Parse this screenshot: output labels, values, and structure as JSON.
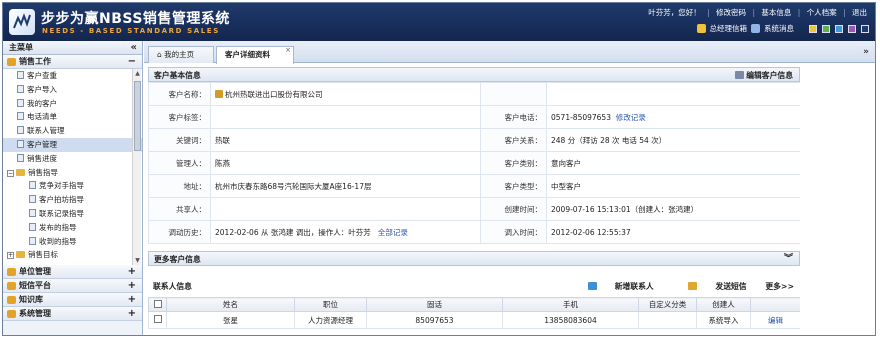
{
  "header": {
    "brand": "步步为赢NBSS销售管理系统",
    "tagline": "NEEDS - BASED STANDARD SALES",
    "user_greeting": "叶芬芳，您好！",
    "links": [
      "修改密码",
      "基本信息",
      "个人档案",
      "退出"
    ],
    "mailbox": "总经理信箱",
    "messages": "系统消息",
    "theme_colors": [
      "#e8c53a",
      "#5fb04a",
      "#3a9ad9",
      "#9b59b6",
      "#1f3a6a"
    ]
  },
  "sidebar": {
    "title": "主菜单",
    "collapse": "«",
    "group_sales": "销售工作",
    "items": [
      {
        "label": "客户查重",
        "type": "doc",
        "indent": 1
      },
      {
        "label": "客户导入",
        "type": "doc",
        "indent": 1
      },
      {
        "label": "我的客户",
        "type": "doc",
        "indent": 1
      },
      {
        "label": "电话清单",
        "type": "doc",
        "indent": 1
      },
      {
        "label": "联系人管理",
        "type": "doc",
        "indent": 1
      },
      {
        "label": "客户管理",
        "type": "doc",
        "indent": 1,
        "selected": true
      },
      {
        "label": "销售进度",
        "type": "doc",
        "indent": 1
      },
      {
        "label": "销售指导",
        "type": "folder",
        "indent": 0
      },
      {
        "label": "竞争对手指导",
        "type": "doc",
        "indent": 2
      },
      {
        "label": "客户拍坊指导",
        "type": "doc",
        "indent": 2
      },
      {
        "label": "联系记录指导",
        "type": "doc",
        "indent": 2
      },
      {
        "label": "发布的指导",
        "type": "doc",
        "indent": 2
      },
      {
        "label": "收到的指导",
        "type": "doc",
        "indent": 2
      },
      {
        "label": "销售目标",
        "type": "folder",
        "indent": 0
      }
    ],
    "groups": [
      {
        "label": "单位管理",
        "pm": "+"
      },
      {
        "label": "短信平台",
        "pm": "+"
      },
      {
        "label": "知识库",
        "pm": "+"
      },
      {
        "label": "系统管理",
        "pm": "+"
      }
    ]
  },
  "tabs": [
    {
      "label": "我的主页"
    },
    {
      "label": "客户详细资料",
      "active": true
    }
  ],
  "customer": {
    "section_title": "客户基本信息",
    "edit_action": "编辑客户信息",
    "rows": [
      {
        "l1": "客户名称：",
        "v1": "杭州热联进出口股份有限公司",
        "l2": "",
        "v2": ""
      },
      {
        "l1": "客户标签：",
        "v1": "",
        "l2": "客户电话：",
        "v2": "0571-85097653",
        "v2_link": "修改记录"
      },
      {
        "l1": "关键词：",
        "v1": "热联",
        "l2": "客户关系：",
        "v2": "248 分（拜访 28 次 电话 54 次）"
      },
      {
        "l1": "管理人：",
        "v1": "陈燕",
        "l2": "客户类别：",
        "v2": "意向客户"
      },
      {
        "l1": "地址：",
        "v1": "杭州市庆春东路68号汽轮国际大厦A座16-17层",
        "l2": "客户类型：",
        "v2": "中型客户"
      },
      {
        "l1": "共享人：",
        "v1": "",
        "l2": "创建时间：",
        "v2": "2009-07-16 15:13:01（创建人：张鸿建）"
      },
      {
        "l1": "调动历史：",
        "v1": "2012-02-06 从 张鸿建 调出，操作人：叶芬芳",
        "v1_link": "全部记录",
        "l2": "调入时间：",
        "v2": "2012-02-06 12:55:37"
      }
    ]
  },
  "more_section": {
    "title": "更多客户信息",
    "toggle": "»"
  },
  "contacts": {
    "title": "联系人信息",
    "actions": [
      "新增联系人",
      "发送短信",
      "更多>>"
    ],
    "columns": [
      "",
      "姓名",
      "职位",
      "固话",
      "手机",
      "自定义分类",
      "创建人",
      ""
    ],
    "rows": [
      [
        "",
        "张星",
        "人力资源经理",
        "85097653",
        "13858083604",
        "",
        "系统导入",
        "编辑"
      ]
    ]
  }
}
